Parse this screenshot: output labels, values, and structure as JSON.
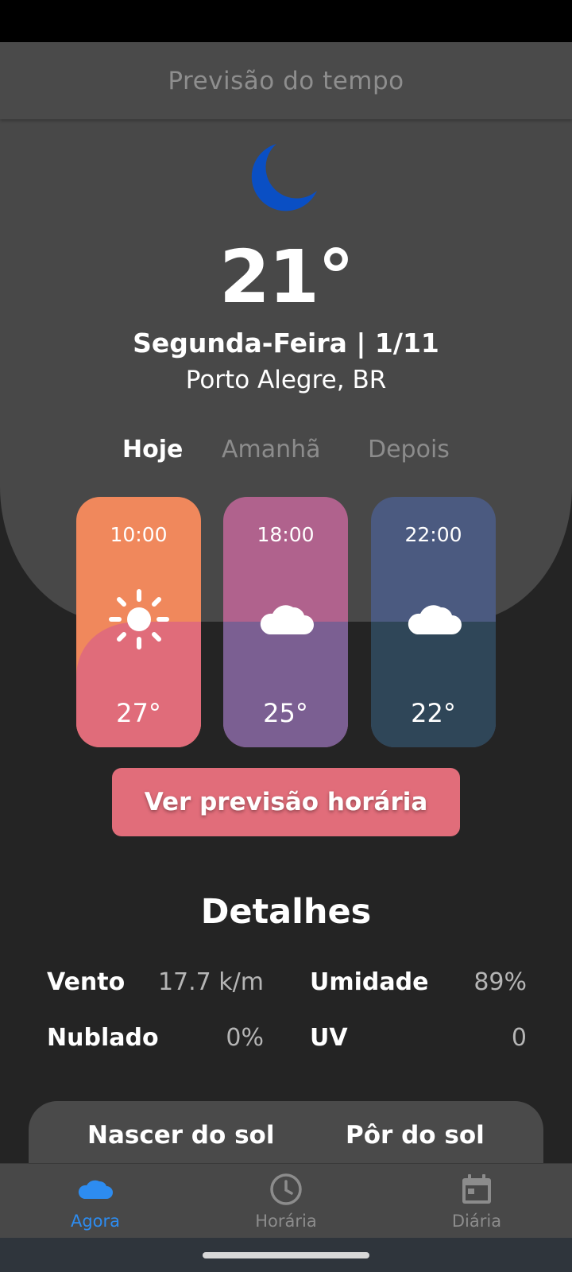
{
  "app_bar": {
    "title": "Previsão do tempo"
  },
  "current": {
    "icon": "moon-icon",
    "icon_color": "#0a4fc4",
    "temperature": "21°",
    "date_line": "Segunda-Feira | 1/11",
    "location": "Porto Alegre, BR"
  },
  "tabs": [
    {
      "label": "Hoje",
      "active": true
    },
    {
      "label": "Amanhã",
      "active": false
    },
    {
      "label": "Depois",
      "active": false
    }
  ],
  "hourly_cards": [
    {
      "time": "10:00",
      "icon": "sun-icon",
      "temp": "27°",
      "color_top": "#f0885c",
      "color_bottom": "#e06c7a"
    },
    {
      "time": "18:00",
      "icon": "cloud-icon",
      "temp": "25°",
      "color_top": "#b0628d",
      "color_bottom": "#7b5f92"
    },
    {
      "time": "22:00",
      "icon": "cloud-icon",
      "temp": "22°",
      "color_top": "#4b5a80",
      "color_bottom": "#2f4658"
    }
  ],
  "cta": {
    "label": "Ver previsão horária",
    "color": "#e16d7a"
  },
  "details": {
    "title": "Detalhes",
    "items": [
      {
        "label": "Vento",
        "value": "17.7 k/m"
      },
      {
        "label": "Umidade",
        "value": "89%"
      },
      {
        "label": "Nublado",
        "value": "0%"
      },
      {
        "label": "UV",
        "value": "0"
      }
    ]
  },
  "sun": {
    "sunrise_label": "Nascer do sol",
    "sunset_label": "Pôr do sol"
  },
  "bottom_nav": [
    {
      "label": "Agora",
      "icon": "cloud-icon",
      "active": true
    },
    {
      "label": "Horária",
      "icon": "clock-icon",
      "active": false
    },
    {
      "label": "Diária",
      "icon": "calendar-icon",
      "active": false
    }
  ],
  "colors": {
    "accent": "#2d8cf0",
    "background": "#242424",
    "panel": "#484848"
  }
}
